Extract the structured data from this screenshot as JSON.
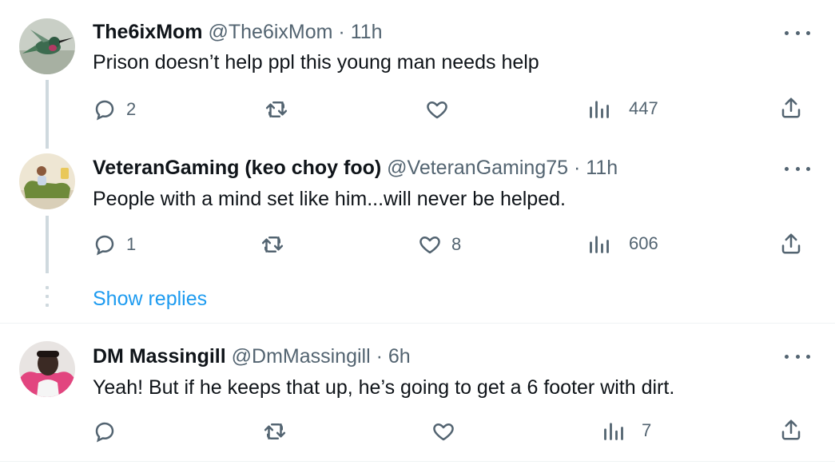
{
  "tweets": [
    {
      "name": "The6ixMom",
      "handle": "@The6ixMom",
      "dot": "·",
      "time": "11h",
      "text": "Prison doesn’t help ppl this young man needs help",
      "replies": "2",
      "retweets": "",
      "likes": "",
      "views": "447",
      "avatar_icon": "hummingbird-avatar"
    },
    {
      "name": "VeteranGaming (keo choy foo)",
      "handle": "@VeteranGaming75",
      "dot": "·",
      "time": "11h",
      "text": "People with a mind set like him...will never be helped.",
      "replies": "1",
      "retweets": "",
      "likes": "8",
      "views": "606",
      "avatar_icon": "person-on-couch-avatar"
    },
    {
      "name": "DM Massingill",
      "handle": "@DmMassingill",
      "dot": "·",
      "time": "6h",
      "text": "Yeah! But if he keeps that up, he’s going to get a 6 footer with dirt.",
      "replies": "",
      "retweets": "",
      "likes": "",
      "views": "7",
      "avatar_icon": "person-photo-avatar"
    }
  ],
  "show_replies_label": "Show replies",
  "colors": {
    "link": "#1d9bf0",
    "secondary": "#536471",
    "primary": "#0f1419",
    "line": "#cfd9de"
  }
}
